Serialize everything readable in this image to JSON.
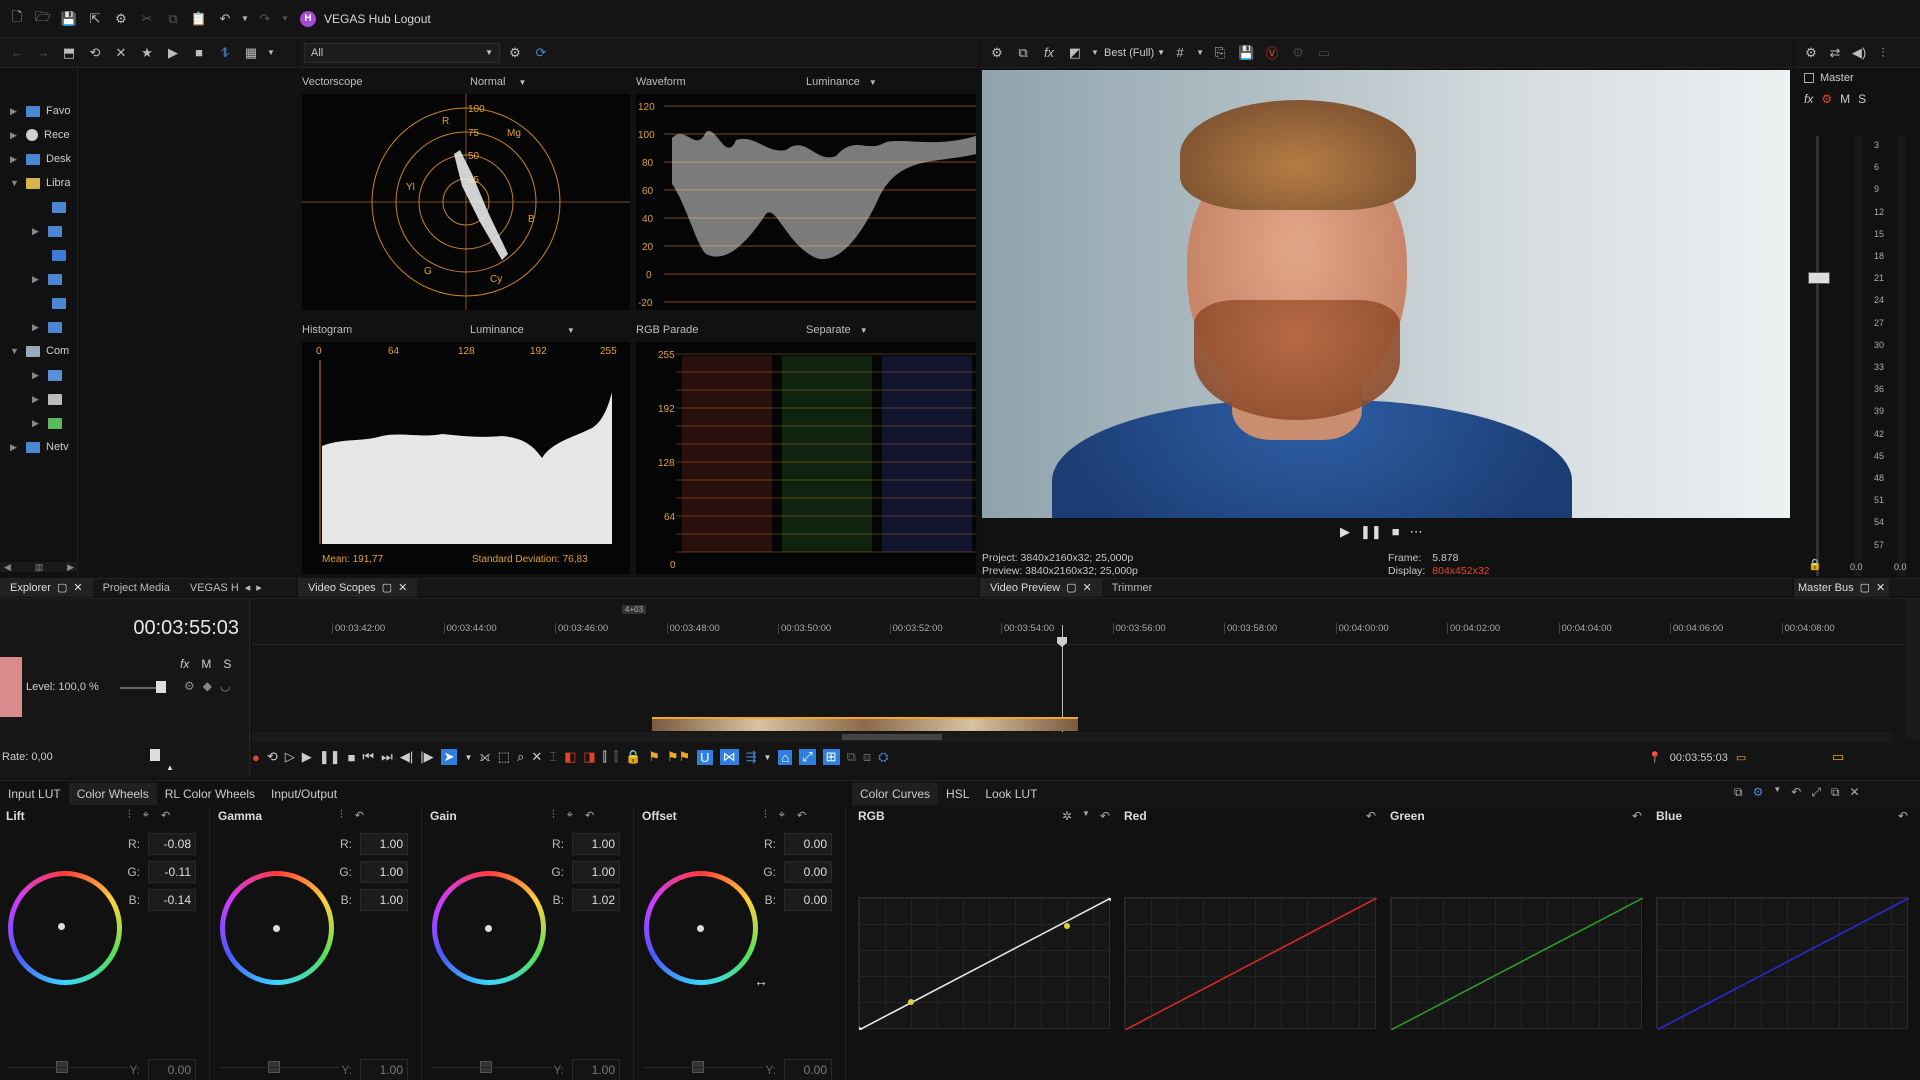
{
  "title_bar": {
    "hub_badge": "H",
    "hub_label": "VEGAS Hub Logout"
  },
  "explorer": {
    "filter_value": "All",
    "tree": [
      {
        "label": "Favo",
        "icon": "star-folder-icon"
      },
      {
        "label": "Rece",
        "icon": "recent-icon"
      },
      {
        "label": "Desk",
        "icon": "desktop-icon"
      },
      {
        "label": "Libra",
        "icon": "folder-icon"
      },
      {
        "label": "Com",
        "icon": "computer-icon"
      },
      {
        "label": "Netv",
        "icon": "network-icon"
      }
    ],
    "tabs": [
      "Explorer",
      "Project Media",
      "VEGAS H"
    ]
  },
  "scopes": {
    "vectorscope": {
      "title": "Vectorscope",
      "mode": "Normal",
      "ring_labels": [
        "100",
        "75",
        "50",
        "25"
      ],
      "targets": [
        "R",
        "Mg",
        "B",
        "Cy",
        "G",
        "Yl"
      ]
    },
    "waveform": {
      "title": "Waveform",
      "mode": "Luminance",
      "ticks": [
        "120",
        "100",
        "80",
        "60",
        "40",
        "20",
        "0",
        "-20"
      ]
    },
    "histogram": {
      "title": "Histogram",
      "mode": "Luminance",
      "ticks": [
        "0",
        "64",
        "128",
        "192",
        "255"
      ],
      "mean": "Mean: 191,77",
      "stddev": "Standard Deviation: 76,83"
    },
    "rgb_parade": {
      "title": "RGB Parade",
      "mode": "Separate",
      "ticks": [
        "255",
        "192",
        "128",
        "64",
        "0"
      ]
    },
    "tab_label": "Video Scopes"
  },
  "preview": {
    "quality": "Best (Full)",
    "project": "Project:   3840x2160x32; 25,000p",
    "preview": "Preview:  3840x2160x32; 25,000p",
    "frame_label": "Frame:",
    "frame_value": "5.878",
    "display_label": "Display:",
    "display_value": "804x452x32",
    "tabs": [
      "Video Preview",
      "Trimmer"
    ]
  },
  "master_bus": {
    "title": "Master",
    "fx": "fx",
    "m": "M",
    "s": "S",
    "scale": [
      "3",
      "6",
      "9",
      "12",
      "15",
      "18",
      "21",
      "24",
      "27",
      "30",
      "33",
      "36",
      "39",
      "42",
      "45",
      "48",
      "51",
      "54",
      "57"
    ],
    "readout_left": "0.0",
    "readout_right": "0.0",
    "tab": "Master Bus"
  },
  "timeline": {
    "timecode": "00:03:55:03",
    "track_level": "Level: 100,0 %",
    "fx": "fx",
    "m": "M",
    "s": "S",
    "rate": "Rate: 0,00",
    "marker_label": "4+03",
    "ruler": [
      "00:03:42:00",
      "00:03:44:00",
      "00:03:46:00",
      "00:03:48:00",
      "00:03:50:00",
      "00:03:52:00",
      "00:03:54:00",
      "00:03:56:00",
      "00:03:58:00",
      "00:04:00:00",
      "00:04:02:00",
      "00:04:04:00",
      "00:04:06:00",
      "00:04:08:00"
    ],
    "transport_timecode": "00:03:55:03"
  },
  "color_grading": {
    "left_tabs": [
      "Input LUT",
      "Color Wheels",
      "RL Color Wheels",
      "Input/Output"
    ],
    "wheels": [
      {
        "name": "Lift",
        "r": "-0.08",
        "g": "-0.11",
        "b": "-0.14",
        "y": "0.00"
      },
      {
        "name": "Gamma",
        "r": "1.00",
        "g": "1.00",
        "b": "1.00",
        "y": "1.00"
      },
      {
        "name": "Gain",
        "r": "1.00",
        "g": "1.00",
        "b": "1.02",
        "y": "1.00"
      },
      {
        "name": "Offset",
        "r": "0.00",
        "g": "0.00",
        "b": "0.00",
        "y": "0.00"
      }
    ],
    "channel_labels": {
      "r": "R:",
      "g": "G:",
      "b": "B:",
      "y": "Y:"
    },
    "right_tabs": [
      "Color Curves",
      "HSL",
      "Look LUT"
    ],
    "curves": [
      {
        "name": "RGB",
        "color": "#e6e6e6"
      },
      {
        "name": "Red",
        "color": "#d22a2a"
      },
      {
        "name": "Green",
        "color": "#2a9a2a"
      },
      {
        "name": "Blue",
        "color": "#2a2ad2"
      }
    ]
  },
  "colors": {
    "accent_blue": "#2f7fe0",
    "record_red": "#e0442f",
    "scope_orange": "#e0a23a",
    "marker_orange": "#f5a623"
  }
}
